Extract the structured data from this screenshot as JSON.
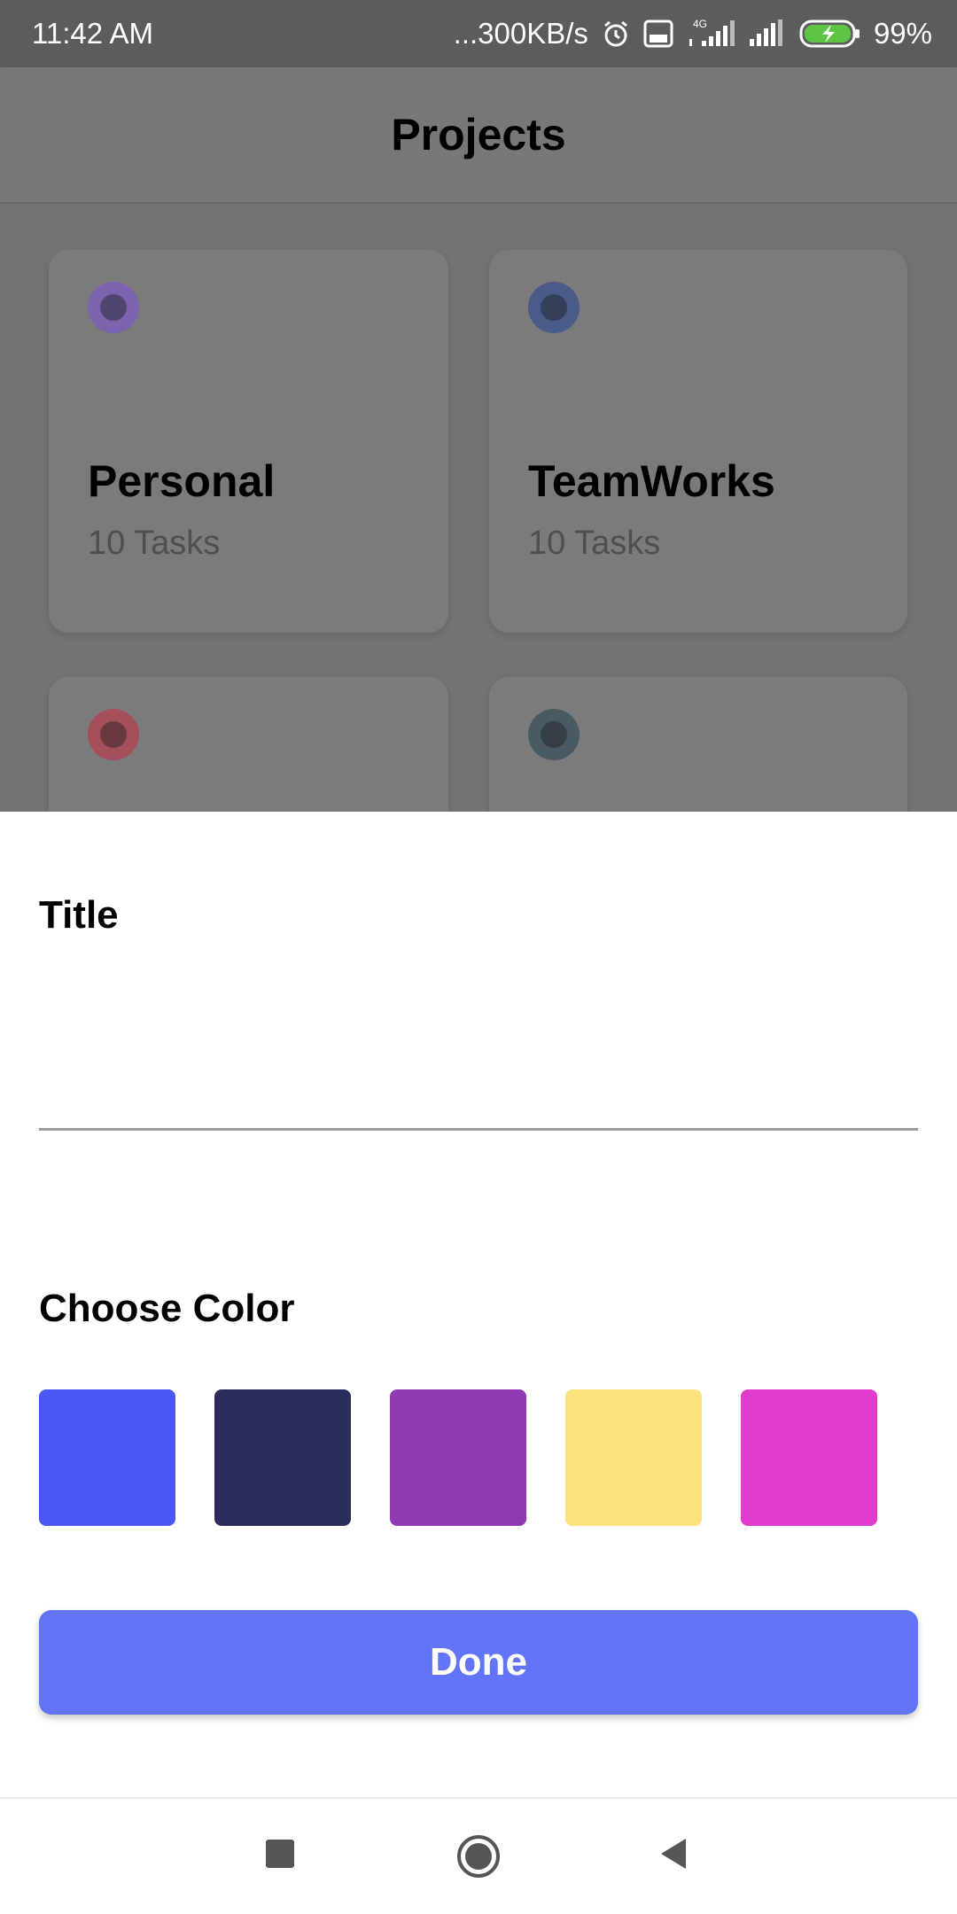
{
  "status_bar": {
    "time": "11:42 AM",
    "network_speed": "...300KB/s",
    "network_type": "4G",
    "volte_label": "Vo LTE",
    "battery": "99%",
    "icons": [
      "alarm-icon",
      "volte-icon",
      "signal-icon",
      "signal-icon-2",
      "battery-charging-icon"
    ]
  },
  "app_bar": {
    "title": "Projects"
  },
  "projects": [
    {
      "name": "Personal",
      "tasks": "10 Tasks",
      "dot_color": "#7b5cc2"
    },
    {
      "name": "TeamWorks",
      "tasks": "10 Tasks",
      "dot_color": "#2f4aa0"
    },
    {
      "name": "",
      "tasks": "",
      "dot_color": "#c0394b"
    },
    {
      "name": "",
      "tasks": "",
      "dot_color": "#213c4f"
    }
  ],
  "sheet": {
    "title_label": "Title",
    "title_value": "",
    "choose_color_label": "Choose Color",
    "colors": [
      "#4a57f3",
      "#2c2c5c",
      "#9039b2",
      "#fce27e",
      "#e03bca"
    ],
    "done_label": "Done",
    "accent_color": "#6174f5"
  },
  "nav_bar": {
    "icons": [
      "recent-apps-icon",
      "home-icon",
      "back-icon"
    ]
  }
}
